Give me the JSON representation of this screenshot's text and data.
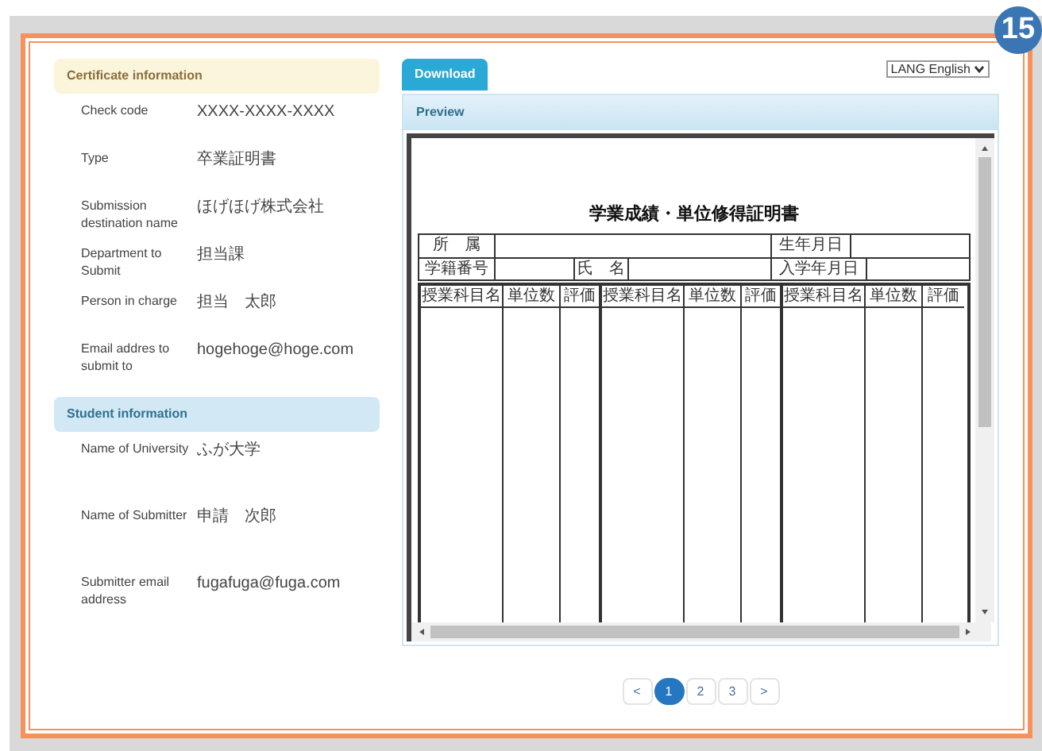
{
  "badge": "15",
  "certificate_section": {
    "title": "Certificate information",
    "fields": [
      {
        "label": "Check code",
        "value": "XXXX-XXXX-XXXX"
      },
      {
        "label": "Type",
        "value": "卒業証明書"
      },
      {
        "label": "Submission destination name",
        "value": "ほげほげ株式会社"
      },
      {
        "label": "Department to Submit",
        "value": "担当課"
      },
      {
        "label": "Person in charge",
        "value": "担当　太郎"
      },
      {
        "label": "Email addres to submit to",
        "value": "hogehoge@hoge.com"
      }
    ]
  },
  "student_section": {
    "title": "Student information",
    "fields": [
      {
        "label": "Name of University",
        "value": "ふが大学"
      },
      {
        "label": "Name of Submitter",
        "value": "申請　次郎"
      },
      {
        "label": "Submitter email address",
        "value": "fugafuga@fuga.com"
      }
    ]
  },
  "download_button": "Download",
  "language_select": {
    "label": "LANG",
    "value": "English"
  },
  "preview": {
    "title": "Preview",
    "document": {
      "title": "学業成績・単位修得証明書",
      "info_rows": [
        [
          "所　属",
          "",
          "生年月日",
          ""
        ],
        [
          "学籍番号",
          "",
          "氏　名",
          "",
          "入学年月日",
          ""
        ]
      ],
      "column_headers": [
        "授業科目名",
        "単位数",
        "評価",
        "授業科目名",
        "単位数",
        "評価",
        "授業科目名",
        "単位数",
        "評価"
      ]
    }
  },
  "pagination": {
    "prev": "<",
    "next": ">",
    "pages": [
      {
        "label": "1",
        "selected": true
      },
      {
        "label": "2",
        "selected": false
      },
      {
        "label": "3",
        "selected": false
      }
    ]
  }
}
